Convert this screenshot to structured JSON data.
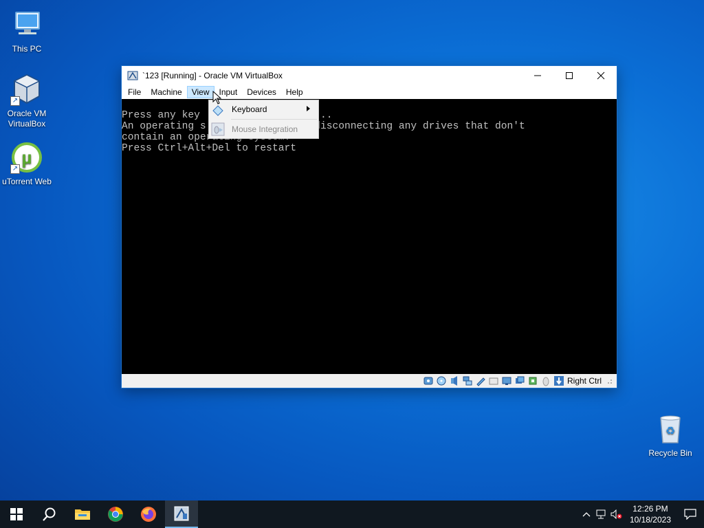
{
  "desktop": {
    "icons": [
      {
        "label": "This PC"
      },
      {
        "label_line1": "Oracle VM",
        "label_line2": "VirtualBox"
      },
      {
        "label": "uTorrent Web"
      },
      {
        "label": "Recycle Bin"
      }
    ]
  },
  "window": {
    "title": "`123 [Running] - Oracle VM VirtualBox",
    "menu": [
      "File",
      "Machine",
      "View",
      "Input",
      "Devices",
      "Help"
    ],
    "active_menu_index": 2,
    "console_lines": [
      "Press any key              DVD.....",
      "An operating s            . Try disconnecting any drives that don't",
      "contain an operating system.",
      "Press Ctrl+Alt+Del to restart"
    ],
    "host_key": "Right Ctrl"
  },
  "dropdown": {
    "items": [
      {
        "label": "Keyboard",
        "has_submenu": true,
        "enabled": true
      },
      {
        "label": "Mouse Integration",
        "has_submenu": false,
        "enabled": false
      }
    ]
  },
  "taskbar": {
    "time": "12:26 PM",
    "date": "10/18/2023"
  },
  "colors": {
    "accent": "#0b6fd6",
    "taskbar": "#101820",
    "menu_highlight": "#cce8ff"
  }
}
